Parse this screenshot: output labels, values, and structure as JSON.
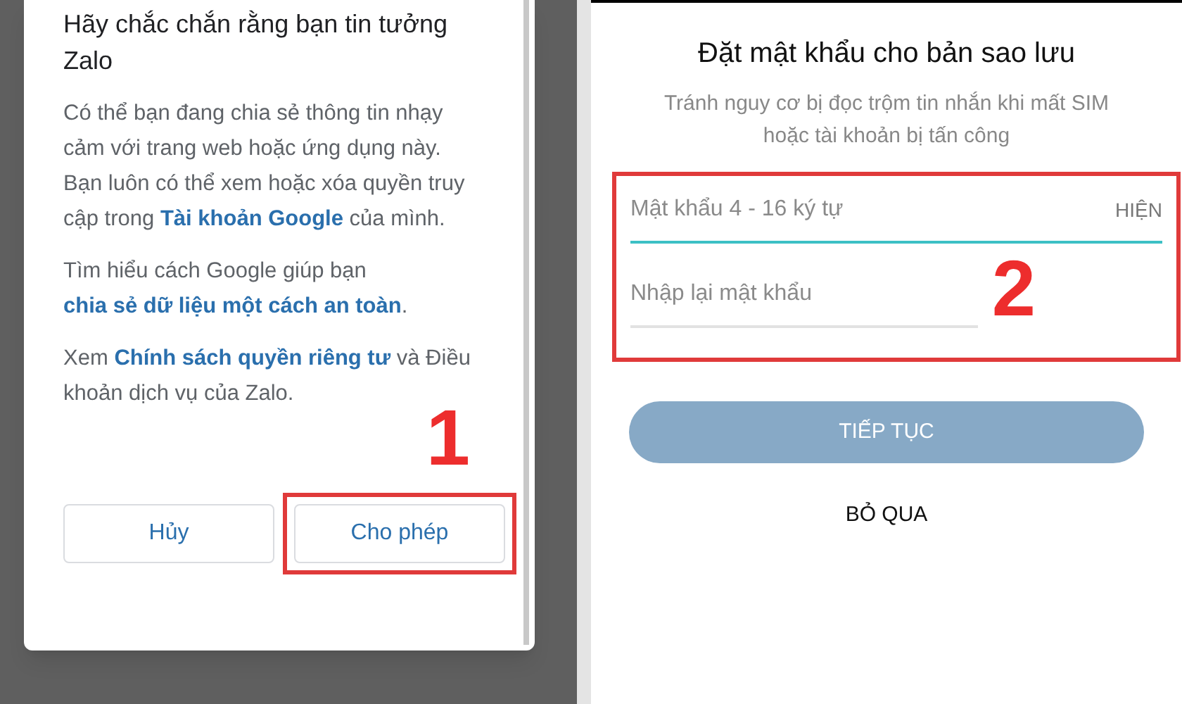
{
  "dialog": {
    "title": "Hãy chắc chắn rằng bạn tin tưởng Zalo",
    "paragraphs": [
      [
        {
          "kind": "text",
          "text": "Có thể bạn đang chia sẻ thông tin nhạy cảm với trang web hoặc ứng dụng này. Bạn luôn có thể xem hoặc xóa quyền truy cập trong "
        },
        {
          "kind": "link",
          "text": "Tài khoản Google"
        },
        {
          "kind": "text",
          "text": " của mình."
        }
      ],
      [
        {
          "kind": "text",
          "text": "Tìm hiểu cách Google giúp bạn "
        },
        {
          "kind": "link",
          "text": "chia sẻ dữ liệu một cách an toàn"
        },
        {
          "kind": "text",
          "text": "."
        }
      ],
      [
        {
          "kind": "text",
          "text": "Xem "
        },
        {
          "kind": "link",
          "text": "Chính sách quyền riêng tư"
        },
        {
          "kind": "text",
          "text": " và Điều khoản dịch vụ của Zalo."
        }
      ]
    ],
    "buttons": [
      {
        "label": "Hủy",
        "highlighted": false
      },
      {
        "label": "Cho phép",
        "highlighted": true
      }
    ],
    "annotation": "1"
  },
  "password_form": {
    "title": "Đặt mật khẩu cho bản sao lưu",
    "subtitle": "Tránh nguy cơ bị đọc trộm tin nhắn khi mất SIM hoặc tài khoản bị tấn công",
    "fields": [
      {
        "placeholder": "Mật khẩu 4 - 16 ký tự",
        "focused": true,
        "toggle": "HIỆN"
      },
      {
        "placeholder": "Nhập lại mật khẩu",
        "focused": false
      }
    ],
    "annotation": "2",
    "continue_button": {
      "label": "TIẾP TỤC",
      "disabled": true
    },
    "skip_button": "BỎ QUA"
  }
}
